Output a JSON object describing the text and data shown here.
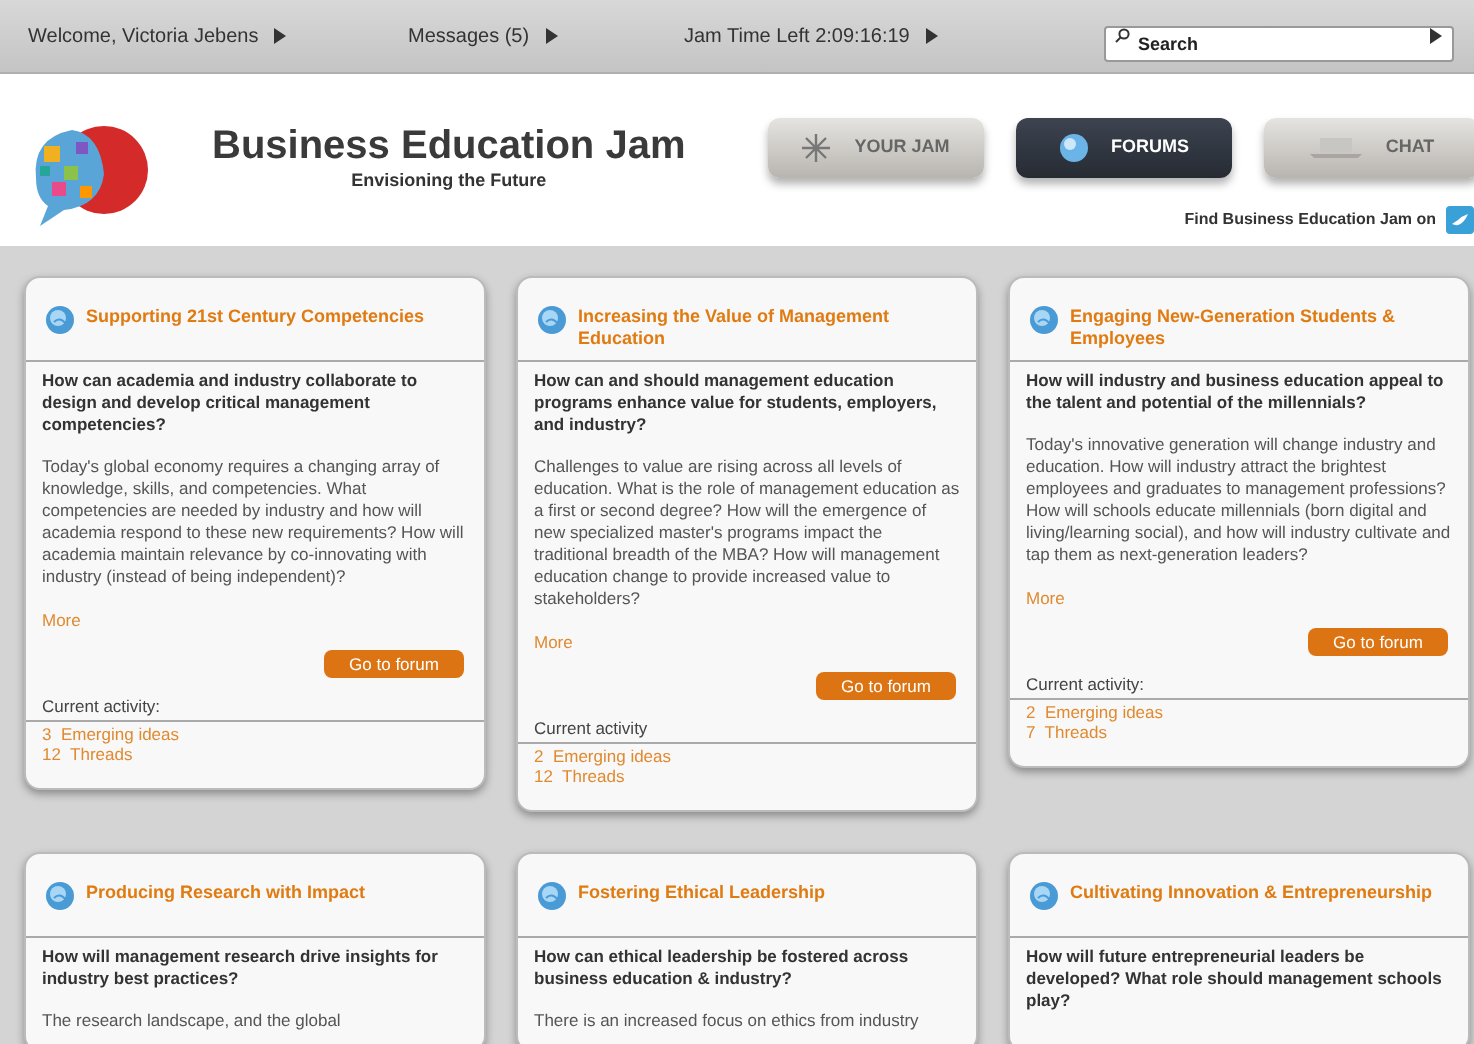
{
  "top_bar": {
    "links": [
      {
        "label": "Welcome, Victoria Jebens"
      },
      {
        "label": "Messages (5)"
      },
      {
        "label": "Jam Time Left 2:09:16:19"
      }
    ],
    "search": {
      "placeholder": "Search"
    }
  },
  "header": {
    "title": "Business Education Jam",
    "subtitle": "Envisioning the Future",
    "tabs": [
      {
        "label": "YOUR JAM",
        "kind": "star",
        "selected": false
      },
      {
        "label": "FORUMS",
        "kind": "globe",
        "selected": true
      },
      {
        "label": "CHAT",
        "kind": "chat",
        "selected": false
      }
    ],
    "social": "Find Business Education Jam on"
  },
  "forums": [
    {
      "title": "Supporting 21st Century Competencies",
      "question": "How can academia and industry collaborate to design and develop critical management competencies?",
      "body": "Today's global economy requires a changing array of knowledge, skills, and competencies. What competencies are needed by industry and how will academia respond to these new requirements? How will academia maintain relevance by co-innovating with industry (instead of being independent)?",
      "more": "More",
      "button": "Go to forum",
      "activity_label": "Current activity:",
      "activity": [
        {
          "count": "3",
          "label": "Emerging ideas"
        },
        {
          "count": "12",
          "label": "Threads"
        }
      ]
    },
    {
      "title": "Increasing the Value of Management Education",
      "question": "How can and should management education programs enhance value for students, employers, and industry?",
      "body": "Challenges to value are rising across all levels of education. What is the role of management education as a first or second degree? How will the emergence of new specialized master's programs impact the traditional breadth of the MBA? How will management education change to provide increased value to stakeholders?",
      "more": "More",
      "button": "Go to forum",
      "activity_label": "Current activity",
      "activity": [
        {
          "count": "2",
          "label": "Emerging ideas"
        },
        {
          "count": "12",
          "label": "Threads"
        }
      ]
    },
    {
      "title": "Engaging New-Generation Students & Employees",
      "question": "How will industry and business education appeal to the talent and potential of the millennials?",
      "body": "Today's innovative generation will change industry and education. How will industry attract the brightest employees and graduates to management professions? How will schools educate millennials (born digital and living/learning social), and how will industry cultivate and tap them as next-generation leaders?",
      "more": "More",
      "button": "Go to forum",
      "activity_label": "Current activity:",
      "activity": [
        {
          "count": "2",
          "label": "Emerging ideas"
        },
        {
          "count": "7",
          "label": "Threads"
        }
      ]
    },
    {
      "title": "Producing Research with Impact",
      "question": "How will management research drive insights for industry best practices?",
      "body": "The research landscape, and the global"
    },
    {
      "title": "Fostering Ethical Leadership",
      "question": "How can ethical leadership be fostered across business education & industry?",
      "body": "There is an increased focus on ethics from industry"
    },
    {
      "title": "Cultivating Innovation & Entrepreneurship",
      "question": "How will future entrepreneurial leaders be developed? What role should management schools play?"
    }
  ]
}
